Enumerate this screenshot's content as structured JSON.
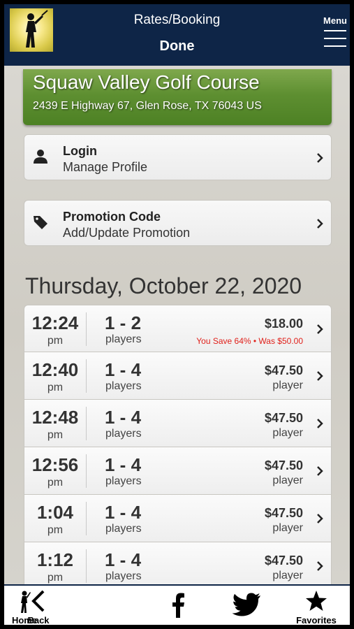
{
  "header": {
    "title": "Rates/Booking",
    "done_label": "Done",
    "menu_label": "Menu"
  },
  "course": {
    "name": "Squaw Valley Golf Course",
    "address": "2439 E Highway 67, Glen Rose, TX 76043 US"
  },
  "login": {
    "title": "Login",
    "subtitle": "Manage Profile",
    "icon": "person-icon"
  },
  "promotion": {
    "title": "Promotion Code",
    "subtitle": "Add/Update Promotion",
    "icon": "tag-icon"
  },
  "date_heading": "Thursday, October 22, 2020",
  "tee_times": [
    {
      "time": "12:24",
      "ampm": "pm",
      "players": "1 - 2",
      "players_label": "players",
      "price": "$18.00",
      "unit": "",
      "savings": "You Save 64% • Was $50.00"
    },
    {
      "time": "12:40",
      "ampm": "pm",
      "players": "1 - 4",
      "players_label": "players",
      "price": "$47.50",
      "unit": "player",
      "savings": ""
    },
    {
      "time": "12:48",
      "ampm": "pm",
      "players": "1 - 4",
      "players_label": "players",
      "price": "$47.50",
      "unit": "player",
      "savings": ""
    },
    {
      "time": "12:56",
      "ampm": "pm",
      "players": "1 - 4",
      "players_label": "players",
      "price": "$47.50",
      "unit": "player",
      "savings": ""
    },
    {
      "time": "1:04",
      "ampm": "pm",
      "players": "1 - 4",
      "players_label": "players",
      "price": "$47.50",
      "unit": "player",
      "savings": ""
    },
    {
      "time": "1:12",
      "ampm": "pm",
      "players": "1 - 4",
      "players_label": "players",
      "price": "$47.50",
      "unit": "player",
      "savings": ""
    }
  ],
  "footer": {
    "back": "Back",
    "home": "Home",
    "facebook": "",
    "twitter": "",
    "favorites": "Favorites"
  },
  "colors": {
    "header_bg": "#0e2547",
    "savings_red": "#e0201a",
    "banner_green": "#5e8f31"
  }
}
